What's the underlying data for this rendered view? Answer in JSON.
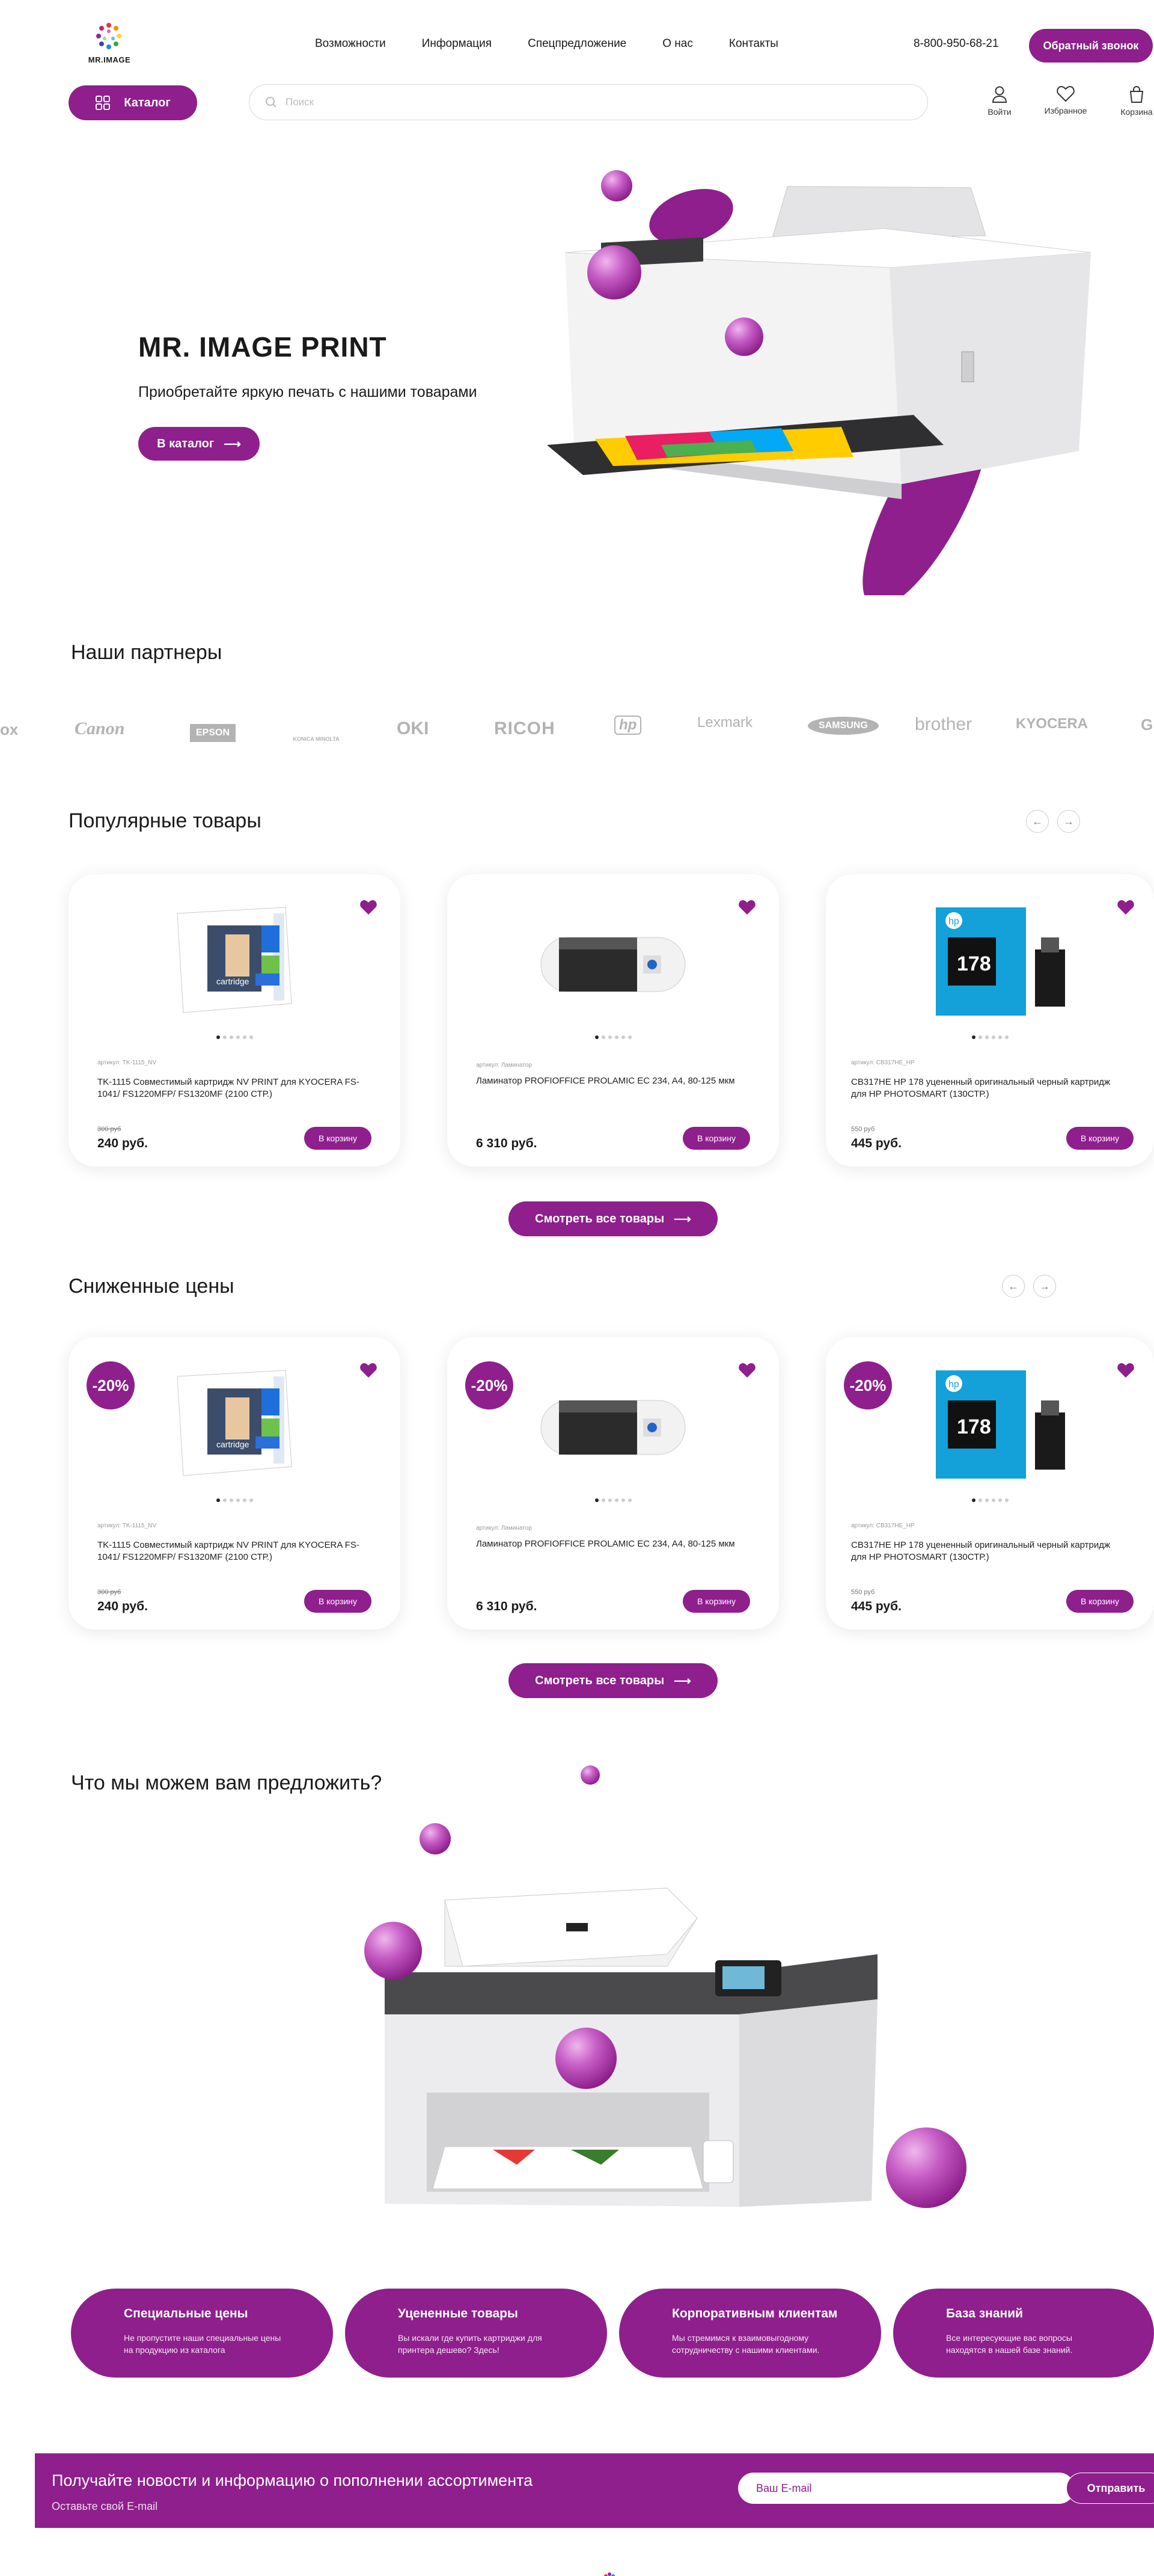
{
  "header": {
    "logo_text": "MR.IMAGE",
    "nav": [
      "Возможности",
      "Информация",
      "Спецпредложение",
      "О нас",
      "Контакты"
    ],
    "phone": "8-800-950-68-21",
    "callback_label": "Обратный звонок",
    "catalog_label": "Каталог",
    "search_placeholder": "Поиск",
    "icons": [
      {
        "label": "Войти",
        "icon": "user-icon"
      },
      {
        "label": "Избранное",
        "icon": "heart-icon"
      },
      {
        "label": "Корзина",
        "icon": "cart-icon"
      }
    ]
  },
  "hero": {
    "title": "MR. IMAGE PRINT",
    "subtitle": "Приобретайте яркую печать с нашими товарами",
    "button_label": "В каталог"
  },
  "partners": {
    "title": "Наши партнеры",
    "items": [
      "ox",
      "Canon",
      "EPSON",
      "KONICA MINOLTA",
      "OKI",
      "RICOH",
      "hp",
      "Lexmark",
      "SAMSUNG",
      "brother",
      "KYOCERA",
      "G"
    ]
  },
  "popular": {
    "title": "Популярные товары",
    "view_all_label": "Смотреть все товары",
    "products": [
      {
        "article": "артикул: TK-1115_NV",
        "name": "TK-1115 Совместимый картридж NV PRINT для KYOCERA FS-1041/ FS1220MFP/ FS1320MF (2100 СТР.)",
        "old_price": "300 руб",
        "price": "240 руб.",
        "cart_label": "В корзину"
      },
      {
        "article": "артикул: Ламинатор",
        "name": "Ламинатор PROFIOFFICE PROLAMIC EC 234, A4, 80-125 мкм",
        "old_price": "",
        "price": "6 310 руб.",
        "cart_label": "В корзину"
      },
      {
        "article": "артикул: CB317HE_HP",
        "name": "CB317HE HP 178 уцененный оригинальный черный картридж для HP PHOTOSMART (130СТР.)",
        "old_price": "550 руб",
        "price": "445 руб.",
        "cart_label": "В корзину"
      }
    ]
  },
  "discounted": {
    "title": "Сниженные цены",
    "badge": "-20%",
    "view_all_label": "Смотреть все товары",
    "products": [
      {
        "article": "артикул: TK-1115_NV",
        "name": "TK-1115 Совместимый картридж NV PRINT для KYOCERA FS-1041/ FS1220MFP/ FS1320MF (2100 СТР.)",
        "old_price": "300 руб",
        "price": "240 руб.",
        "cart_label": "В корзину"
      },
      {
        "article": "артикул: Ламинатор",
        "name": "Ламинатор PROFIOFFICE PROLAMIC EC 234, A4, 80-125 мкм",
        "old_price": "",
        "price": "6 310 руб.",
        "cart_label": "В корзину"
      },
      {
        "article": "артикул: CB317HE_HP",
        "name": "CB317HE HP 178 уцененный оригинальный черный картридж для HP PHOTOSMART (130СТР.)",
        "old_price": "550 руб",
        "price": "445 руб.",
        "cart_label": "В корзину"
      }
    ]
  },
  "offers": {
    "title": "Что мы можем вам предложить?",
    "items": [
      {
        "title": "Специальные цены",
        "text": "Не пропустите наши специальные цены на продукцию из каталога"
      },
      {
        "title": "Уцененные товары",
        "text": "Вы искали где купить картриджи для принтера дешево? Здесь!"
      },
      {
        "title": "Корпоративным клиентам",
        "text": "Мы стремимся к взаимовыгодному сотрудничеству с нашими клиентами."
      },
      {
        "title": "База знаний",
        "text": "Все интересующие вас вопросы находятся в нашей базе знаний."
      }
    ]
  },
  "newsletter": {
    "title": "Получайте новости и информацию о пополнении ассортимента",
    "subtitle": "Оставьте свой E-mail",
    "placeholder": "Ваш E-mail",
    "button_label": "Отправить"
  },
  "colors": {
    "accent": "#8e1f8c"
  }
}
